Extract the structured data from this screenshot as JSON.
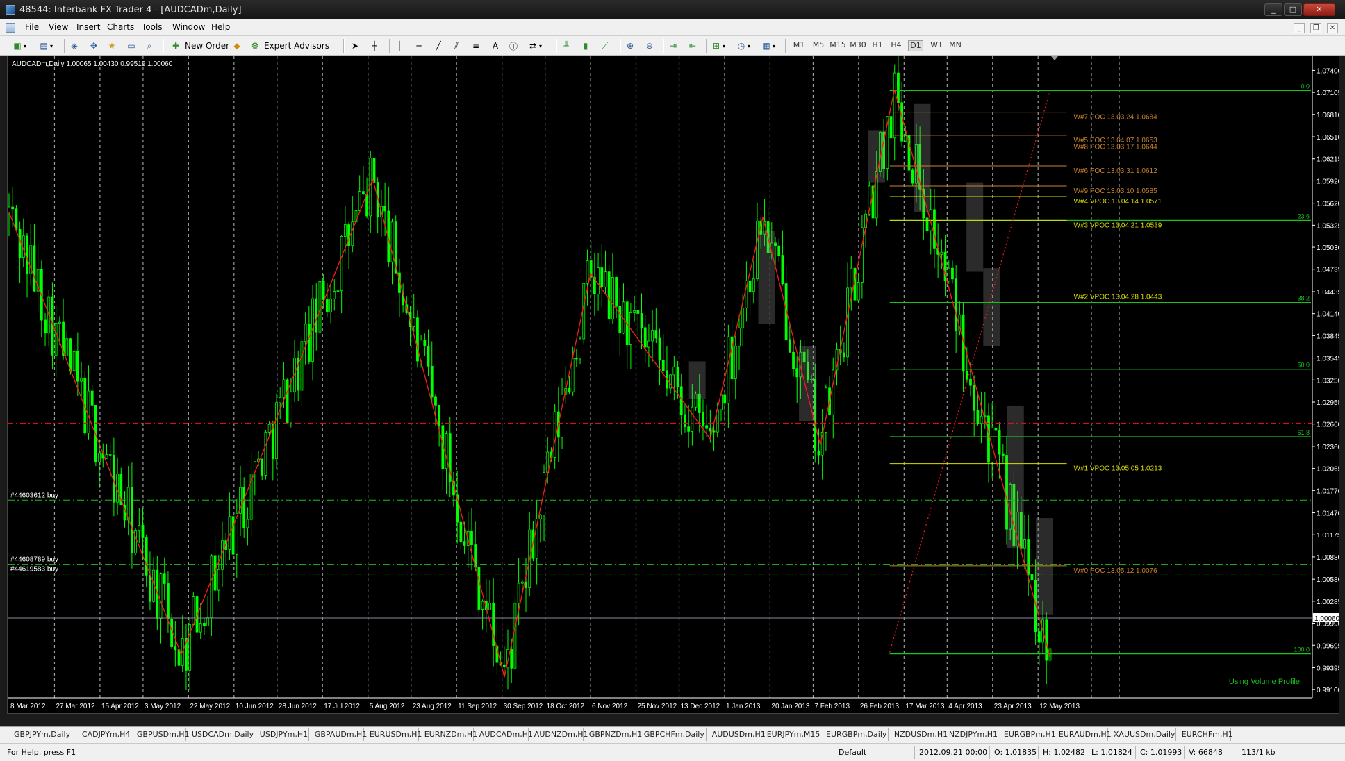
{
  "window": {
    "title": "48544: Interbank FX Trader 4 - [AUDCADm,Daily]",
    "minimize": "_",
    "maximize": "□",
    "close": "✕"
  },
  "menu": {
    "items": [
      "File",
      "View",
      "Insert",
      "Charts",
      "Tools",
      "Window",
      "Help"
    ],
    "mdi_minimize": "_",
    "mdi_restore": "❐",
    "mdi_close": "✕"
  },
  "toolbar": {
    "new_order": "New Order",
    "expert_advisors": "Expert Advisors",
    "timeframes": [
      "M1",
      "M5",
      "M15",
      "M30",
      "H1",
      "H4",
      "D1",
      "W1",
      "MN"
    ],
    "active_timeframe": "D1"
  },
  "chart": {
    "info": "AUDCADm,Daily  1.00065 1.00430 0.99519 1.00060",
    "footer_label": "Using Volume Profile",
    "colors": {
      "background": "#000000",
      "candles": "#00ff00",
      "zigzag": "#ff1a1a",
      "fib": "#19c319",
      "poc": "#c8822d",
      "vpoc": "#dcdc00",
      "grid": "#d0d0d0",
      "bid_line": "#8a8aa0"
    },
    "y_axis_labels": [
      "1.07400",
      "1.07105",
      "1.06810",
      "1.06510",
      "1.06215",
      "1.05920",
      "1.05620",
      "1.05325",
      "1.05030",
      "1.04735",
      "1.04435",
      "1.04140",
      "1.03845",
      "1.03545",
      "1.03250",
      "1.02955",
      "1.02660",
      "1.02360",
      "1.02065",
      "1.01770",
      "1.01470",
      "1.01175",
      "1.00880",
      "1.00580",
      "1.00285",
      "0.99990",
      "0.99695",
      "0.99395",
      "0.99100"
    ],
    "current_price": "1.00060",
    "x_axis_labels": [
      "8 Mar 2012",
      "27 Mar 2012",
      "15 Apr 2012",
      "3 May 2012",
      "22 May 2012",
      "10 Jun 2012",
      "28 Jun 2012",
      "17 Jul 2012",
      "5 Aug 2012",
      "23 Aug 2012",
      "11 Sep 2012",
      "30 Sep 2012",
      "18 Oct 2012",
      "6 Nov 2012",
      "25 Nov 2012",
      "13 Dec 2012",
      "1 Jan 2013",
      "20 Jan 2013",
      "7 Feb 2013",
      "26 Feb 2013",
      "17 Mar 2013",
      "4 Apr 2013",
      "23 Apr 2013",
      "12 May 2013"
    ],
    "fib_levels": [
      {
        "label": "0.0",
        "price": 1.0713
      },
      {
        "label": "23.6",
        "price": 1.0539
      },
      {
        "label": "38.2",
        "price": 1.0429
      },
      {
        "label": "50.0",
        "price": 1.03395
      },
      {
        "label": "61.8",
        "price": 1.0249
      },
      {
        "label": "100.0",
        "price": 0.9958
      }
    ],
    "order_lines": [
      {
        "label": "#44603612 buy",
        "price": 1.0164
      },
      {
        "label": "#44608789 buy",
        "price": 1.0078
      },
      {
        "label": "#44619583 buy",
        "price": 1.0065
      }
    ],
    "red_level": 1.0267,
    "poc_labels": [
      {
        "text": "W#7.POC 13.03.24 1.0684",
        "price": 1.0684,
        "kind": "poc"
      },
      {
        "text": "W#5.POC 13.04.07 1.0653",
        "price": 1.0653,
        "kind": "poc"
      },
      {
        "text": "W#8.POC 13.03.17 1.0644",
        "price": 1.0644,
        "kind": "poc"
      },
      {
        "text": "W#6.POC 13.03.31 1.0612",
        "price": 1.0612,
        "kind": "poc"
      },
      {
        "text": "W#9.POC 13.03.10 1.0585",
        "price": 1.0585,
        "kind": "poc"
      },
      {
        "text": "W#4.VPOC 13.04.14 1.0571",
        "price": 1.0571,
        "kind": "vpoc"
      },
      {
        "text": "W#3.VPOC 13.04.21 1.0539",
        "price": 1.0539,
        "kind": "vpoc"
      },
      {
        "text": "W#2.VPOC 13.04.28 1.0443",
        "price": 1.0443,
        "kind": "vpoc"
      },
      {
        "text": "W#1.VPOC 13.05.05 1.0213",
        "price": 1.0213,
        "kind": "vpoc"
      },
      {
        "text": "W#0.POC 13.05.12 1.0076",
        "price": 1.0076,
        "kind": "poc"
      }
    ],
    "zigzag_points": [
      {
        "date": "2012-03-08",
        "price": 1.055
      },
      {
        "date": "2012-05-19",
        "price": 0.9957
      },
      {
        "date": "2012-08-07",
        "price": 1.0594
      },
      {
        "date": "2012-10-01",
        "price": 0.9927
      },
      {
        "date": "2012-11-06",
        "price": 1.0468
      },
      {
        "date": "2012-12-26",
        "price": 1.0246
      },
      {
        "date": "2013-01-17",
        "price": 1.0543
      },
      {
        "date": "2013-02-10",
        "price": 1.0238
      },
      {
        "date": "2013-03-13",
        "price": 1.0714
      },
      {
        "date": "2013-05-17",
        "price": 0.9954
      }
    ],
    "dotted_trend": [
      {
        "date": "2013-03-11",
        "price": 0.996
      },
      {
        "date": "2013-05-17",
        "price": 1.0713
      }
    ]
  },
  "symbol_tabs": [
    "GBPJPYm,Daily",
    "CADJPYm,H4",
    "GBPUSDm,H1",
    "USDCADm,Daily",
    "USDJPYm,H1",
    "GBPAUDm,H1",
    "EURUSDm,H1",
    "EURNZDm,H1",
    "AUDCADm,H1",
    "AUDNZDm,H1",
    "GBPNZDm,H1",
    "GBPCHFm,Daily",
    "AUDUSDm,H1",
    "EURJPYm,M15",
    "EURGBPm,Daily",
    "NZDUSDm,H1",
    "NZDJPYm,H1",
    "EURGBPm,H1",
    "EURAUDm,H1",
    "XAUUSDm,Daily",
    "EURCHFm,H1"
  ],
  "status": {
    "help": "For Help, press F1",
    "profile": "Default",
    "datetime": "2012.09.21 00:00",
    "open": "O: 1.01835",
    "high": "H: 1.02482",
    "low": "L: 1.01824",
    "close": "C: 1.01993",
    "volume": "V: 66848",
    "traffic": "113/1 kb"
  }
}
